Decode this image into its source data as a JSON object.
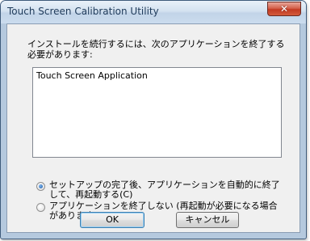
{
  "window": {
    "title": "Touch Screen Calibration Utility",
    "close_icon": "✕"
  },
  "message": "インストールを続行するには、次のアプリケーションを終了する必要があります:",
  "app_list": {
    "items": [
      "Touch Screen Application"
    ]
  },
  "options": [
    {
      "label": "セットアップの完了後、アプリケーションを自動的に終了して、再起動する(C)",
      "checked": true
    },
    {
      "label": "アプリケーションを終了しない (再起動が必要になる場合があります)(N)",
      "checked": false
    }
  ],
  "buttons": {
    "ok": "OK",
    "cancel": "キャンセル"
  }
}
